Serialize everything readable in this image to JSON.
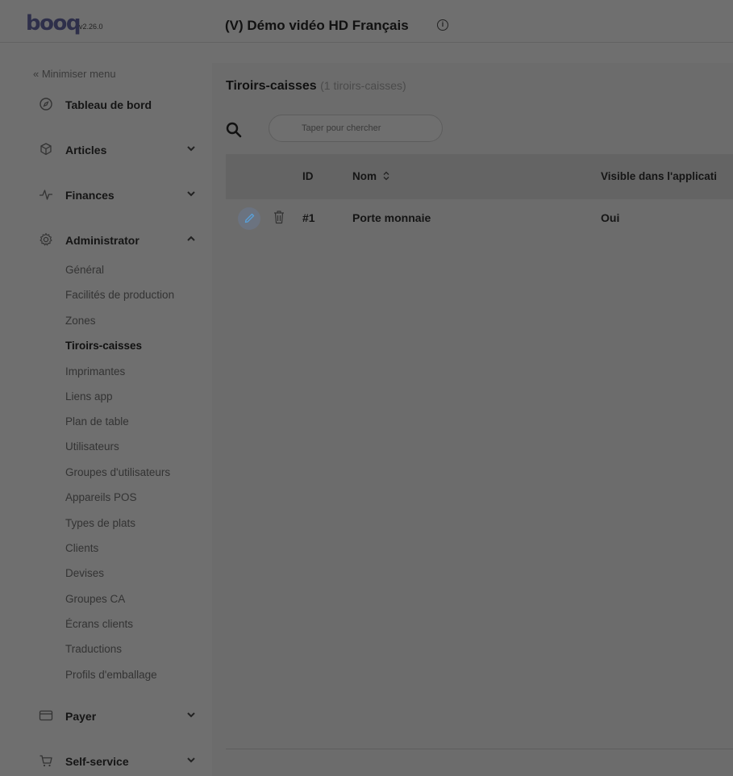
{
  "app": {
    "logo": "booq",
    "version": "v2.26.0",
    "title": "(V) Démo vidéo HD Français"
  },
  "sidebar": {
    "minimize": "« Minimiser menu",
    "items": [
      {
        "label": "Tableau de bord",
        "icon": "compass-icon"
      },
      {
        "label": "Articles",
        "icon": "box-icon"
      },
      {
        "label": "Finances",
        "icon": "pulse-icon"
      },
      {
        "label": "Administrator",
        "icon": "gear-icon"
      },
      {
        "label": "Payer",
        "icon": "card-icon"
      },
      {
        "label": "Self-service",
        "icon": "cart-icon"
      }
    ],
    "admin_sub": [
      "Général",
      "Facilités de production",
      "Zones",
      "Tiroirs-caisses",
      "Imprimantes",
      "Liens app",
      "Plan de table",
      "Utilisateurs",
      "Groupes d'utilisateurs",
      "Appareils POS",
      "Types de plats",
      "Clients",
      "Devises",
      "Groupes CA",
      "Écrans clients",
      "Traductions",
      "Profils d'emballage"
    ],
    "active_sub": "Tiroirs-caisses"
  },
  "main": {
    "title": "Tiroirs-caisses",
    "count": "(1 tiroirs-caisses)",
    "search_placeholder": "Taper pour chercher",
    "columns": {
      "id": "ID",
      "name": "Nom",
      "visible": "Visible dans l'applicati"
    },
    "rows": [
      {
        "id": "#1",
        "name": "Porte monnaie",
        "visible": "Oui"
      }
    ]
  },
  "colors": {
    "accent": "#2e2f4a",
    "edit_accent": "#5aa0d8"
  }
}
